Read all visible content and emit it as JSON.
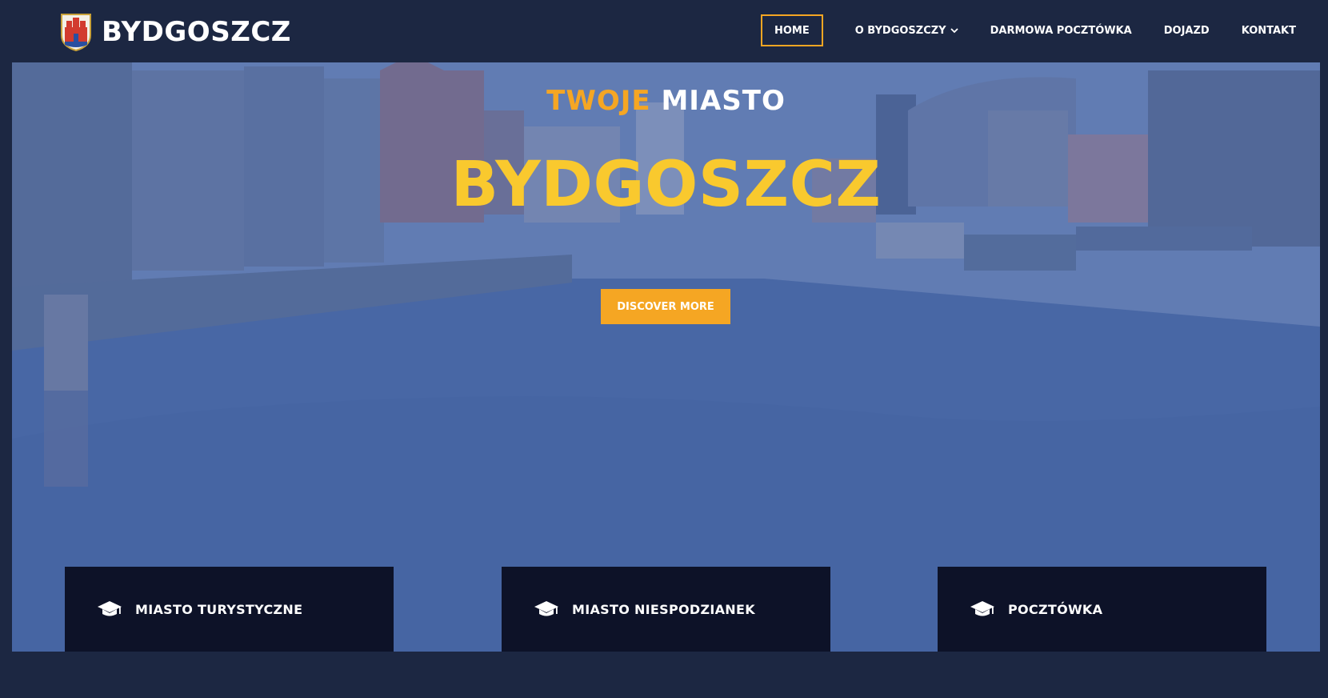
{
  "header": {
    "logo_text": "BYDGOSZCZ",
    "nav": [
      {
        "label": "HOME",
        "active": true
      },
      {
        "label": "O BYDGOSZCZY",
        "has_dropdown": true
      },
      {
        "label": "DARMOWA POCZTÓWKA"
      },
      {
        "label": "DOJAZD"
      },
      {
        "label": "KONTAKT"
      }
    ]
  },
  "hero": {
    "subtitle_accent": "TWOJE",
    "subtitle_plain": "MIASTO",
    "title": "BYDGOSZCZ",
    "cta_label": "DISCOVER MORE"
  },
  "cards": [
    {
      "label": "MIASTO TURYSTYCZNE",
      "icon": "graduation-cap-icon"
    },
    {
      "label": "MIASTO NIESPODZIANEK",
      "icon": "graduation-cap-icon"
    },
    {
      "label": "POCZTÓWKA",
      "icon": "graduation-cap-icon"
    }
  ],
  "colors": {
    "background": "#1c2742",
    "accent": "#f5a623",
    "title": "#f9c92e",
    "card": "#0d1228"
  }
}
